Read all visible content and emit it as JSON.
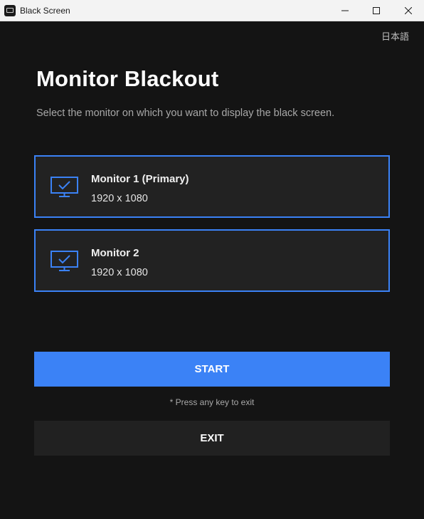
{
  "window": {
    "title": "Black Screen",
    "icons": {
      "app": "monitor-app-icon",
      "minimize": "minimize-icon",
      "maximize": "maximize-icon",
      "close": "close-icon"
    }
  },
  "language_link": "日本語",
  "heading": "Monitor Blackout",
  "subtitle": "Select the monitor on which you want to display the black screen.",
  "monitors": [
    {
      "name": "Monitor 1 (Primary)",
      "resolution": "1920 x 1080",
      "selected": true,
      "icon": "monitor-check-icon"
    },
    {
      "name": "Monitor 2",
      "resolution": "1920 x 1080",
      "selected": true,
      "icon": "monitor-check-icon"
    }
  ],
  "start_button": "START",
  "exit_hint": "* Press any key to exit",
  "exit_button": "EXIT",
  "colors": {
    "accent": "#3b82f6",
    "background": "#141414",
    "card": "#222222",
    "titlebar": "#f3f3f3"
  }
}
